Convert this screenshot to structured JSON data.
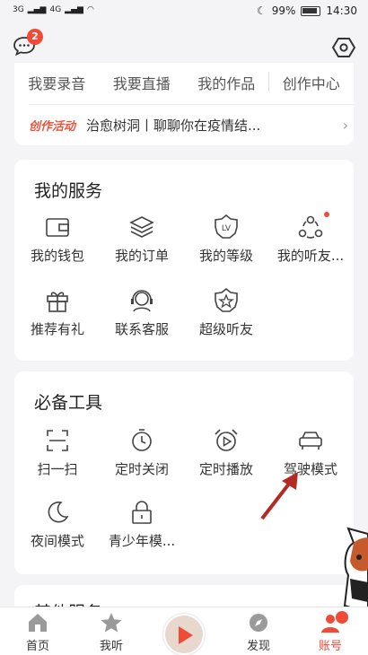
{
  "status_bar": {
    "signal_left": "3G",
    "signal_right": "4G",
    "battery": "99%",
    "time": "14:30"
  },
  "header": {
    "message_badge": "2"
  },
  "creator": {
    "items": [
      "我要录音",
      "我要直播",
      "我的作品",
      "创作中心"
    ],
    "activity_tag": "创作活动",
    "activity_text": "治愈树洞丨聊聊你在疫情结...",
    "activity_arrow": "›"
  },
  "services": {
    "title": "我的服务",
    "items": [
      {
        "label": "我的钱包",
        "icon": "wallet-icon"
      },
      {
        "label": "我的订单",
        "icon": "orders-icon"
      },
      {
        "label": "我的等级",
        "icon": "level-icon"
      },
      {
        "label": "我的听友...",
        "icon": "friends-icon"
      },
      {
        "label": "推荐有礼",
        "icon": "gift-icon"
      },
      {
        "label": "联系客服",
        "icon": "customer-service-icon"
      },
      {
        "label": "超级听友",
        "icon": "super-listener-icon"
      }
    ]
  },
  "tools": {
    "title": "必备工具",
    "items": [
      {
        "label": "扫一扫",
        "icon": "scan-icon"
      },
      {
        "label": "定时关闭",
        "icon": "timer-off-icon"
      },
      {
        "label": "定时播放",
        "icon": "alarm-play-icon"
      },
      {
        "label": "驾驶模式",
        "icon": "car-icon"
      },
      {
        "label": "夜间模式",
        "icon": "moon-icon"
      },
      {
        "label": "青少年模...",
        "icon": "lock-icon"
      }
    ]
  },
  "other": {
    "title": "其他服务"
  },
  "level_icon_text": "LV",
  "bottom_nav": {
    "tabs": [
      {
        "label": "首页",
        "icon": "home-icon"
      },
      {
        "label": "我听",
        "icon": "star-icon"
      },
      {
        "label": "发现",
        "icon": "discover-icon"
      },
      {
        "label": "账号",
        "icon": "account-icon"
      }
    ],
    "active": "账号"
  },
  "colors": {
    "accent": "#ef4b36",
    "background": "#f4f4f6",
    "card": "#ffffff"
  }
}
